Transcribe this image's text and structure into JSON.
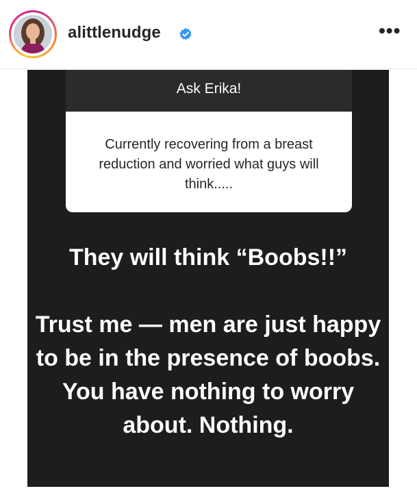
{
  "header": {
    "username": "alittlenudge",
    "more_label": "•••"
  },
  "story": {
    "question_title": "Ask Erika!",
    "question_text": "Currently recovering from a breast reduction and worried what guys will think.....",
    "answer_line1": "They will think “Boobs!!”",
    "answer_line2": "Trust me — men are just happy to be in the presence of boobs. You have nothing to worry about. Nothing."
  },
  "colors": {
    "story_background": "#1d1d1d",
    "card_header": "#2b2b2b",
    "verified_badge": "#3897f0"
  }
}
